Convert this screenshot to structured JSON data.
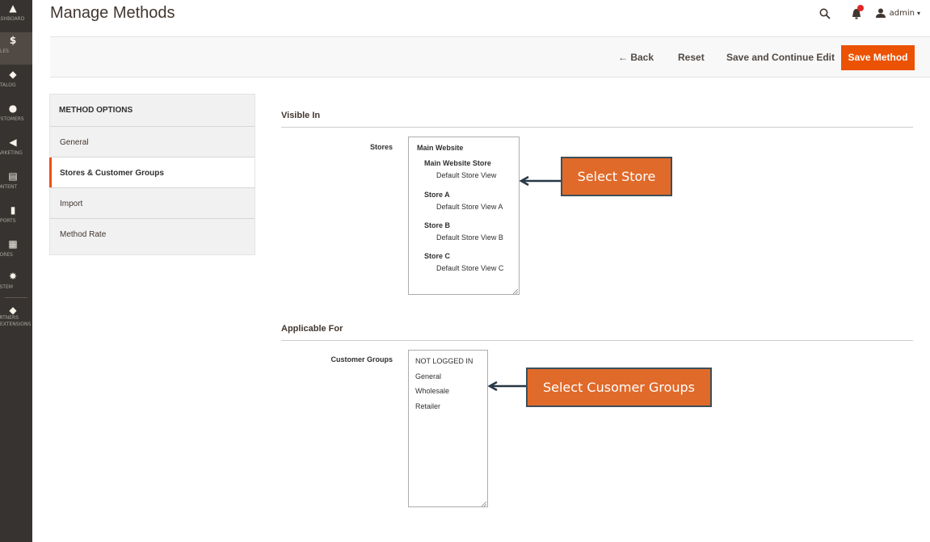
{
  "nav": {
    "items": [
      {
        "label": "DASHBOARD",
        "icon": "dashboard-icon",
        "glyph": "▲"
      },
      {
        "label": "SALES",
        "icon": "dollar-icon",
        "glyph": "$"
      },
      {
        "label": "CATALOG",
        "icon": "cube-icon",
        "glyph": "◆"
      },
      {
        "label": "CUSTOMERS",
        "icon": "customers-icon",
        "glyph": "●"
      },
      {
        "label": "MARKETING",
        "icon": "megaphone-icon",
        "glyph": "◀"
      },
      {
        "label": "CONTENT",
        "icon": "content-icon",
        "glyph": "▤"
      },
      {
        "label": "REPORTS",
        "icon": "reports-icon",
        "glyph": "▮"
      },
      {
        "label": "STORES",
        "icon": "stores-icon",
        "glyph": "▦"
      },
      {
        "label": "SYSTEM",
        "icon": "gear-icon",
        "glyph": "✸"
      },
      {
        "label": "PARTNERS EXTENSIONS",
        "icon": "extensions-icon",
        "glyph": "◆"
      }
    ]
  },
  "header": {
    "title": "Manage Methods",
    "user": "admin"
  },
  "actions": {
    "back": "Back",
    "reset": "Reset",
    "save_continue": "Save and Continue Edit",
    "save": "Save Method"
  },
  "tabs": {
    "title": "METHOD OPTIONS",
    "items": [
      "General",
      "Stores & Customer Groups",
      "Import",
      "Method Rate"
    ],
    "active": "Stores & Customer Groups"
  },
  "visible_in": {
    "title": "Visible In",
    "stores_label": "Stores",
    "options": [
      {
        "text": "Main Website",
        "level": 0
      },
      {
        "text": "Main Website Store",
        "level": 1
      },
      {
        "text": "Default Store View",
        "level": 2
      },
      {
        "text": "Store A",
        "level": 1
      },
      {
        "text": "Default Store View A",
        "level": 2
      },
      {
        "text": "Store B",
        "level": 1
      },
      {
        "text": "Default Store View B",
        "level": 2
      },
      {
        "text": "Store C",
        "level": 1
      },
      {
        "text": "Default Store View C",
        "level": 2
      }
    ]
  },
  "applicable_for": {
    "title": "Applicable For",
    "groups_label": "Customer Groups",
    "options": [
      "NOT LOGGED IN",
      "General",
      "Wholesale",
      "Retailer"
    ]
  },
  "callouts": {
    "store": "Select Store",
    "groups": "Select Cusomer Groups"
  },
  "colors": {
    "accent": "#eb5202",
    "callout": "#e06a2a",
    "nav_bg": "#373330"
  }
}
